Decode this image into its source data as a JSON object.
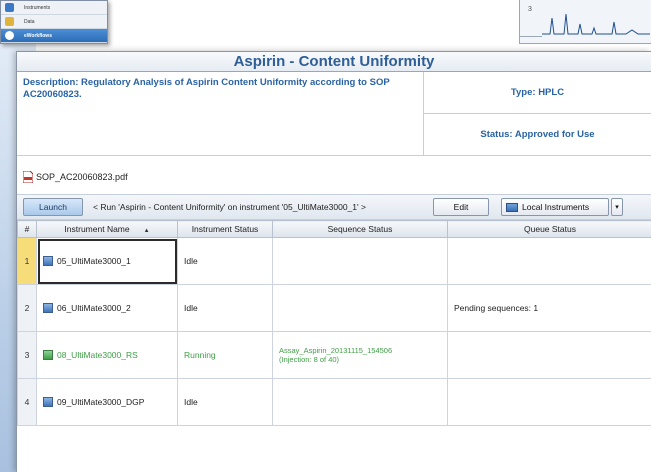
{
  "nav_panel": {
    "items": [
      {
        "label": "Instruments",
        "icon": "instruments-icon",
        "color": "#3c78c8"
      },
      {
        "label": "Data",
        "icon": "data-folder-icon",
        "color": "#e0b43c"
      },
      {
        "label": "eWorkflows",
        "icon": "eworkflows-icon",
        "color": "#2f7ed8",
        "active": true
      }
    ]
  },
  "background_chart": {
    "row_number": "3"
  },
  "window": {
    "title": "Aspirin - Content Uniformity",
    "description": "Description: Regulatory Analysis of Aspirin Content Uniformity according to SOP AC20060823.",
    "type": "Type: HPLC",
    "status": "Status: Approved for Use"
  },
  "attachment": {
    "filename": "SOP_AC20060823.pdf",
    "icon": "pdf-icon"
  },
  "toolbar": {
    "launch_label": "Launch",
    "run_text": "< Run 'Aspirin - Content Uniformity' on instrument '05_UltiMate3000_1' >",
    "edit_label": "Edit",
    "local_label": "Local Instruments",
    "dropdown_symbol": "▾"
  },
  "table": {
    "headers": [
      "#",
      "Instrument Name",
      "Instrument Status",
      "Sequence Status",
      "Queue Status"
    ],
    "rows": [
      {
        "num": "1",
        "name": "05_UltiMate3000_1",
        "status": "Idle",
        "seq": "",
        "seq2": "",
        "queue": ""
      },
      {
        "num": "2",
        "name": "06_UltiMate3000_2",
        "status": "Idle",
        "seq": "",
        "seq2": "",
        "queue": "Pending sequences: 1"
      },
      {
        "num": "3",
        "name": "08_UltiMate3000_RS",
        "status": "Running",
        "seq": "Assay_Aspirin_20131115_154506",
        "seq2": "(Injection: 8 of 40)",
        "queue": ""
      },
      {
        "num": "4",
        "name": "09_UltiMate3000_DGP",
        "status": "Idle",
        "seq": "",
        "seq2": "",
        "queue": ""
      }
    ]
  },
  "colors": {
    "title_blue": "#2f5e97",
    "label_blue": "#2a63a4",
    "running_green": "#3f9e46",
    "selected_row": "#f7dc7a"
  }
}
